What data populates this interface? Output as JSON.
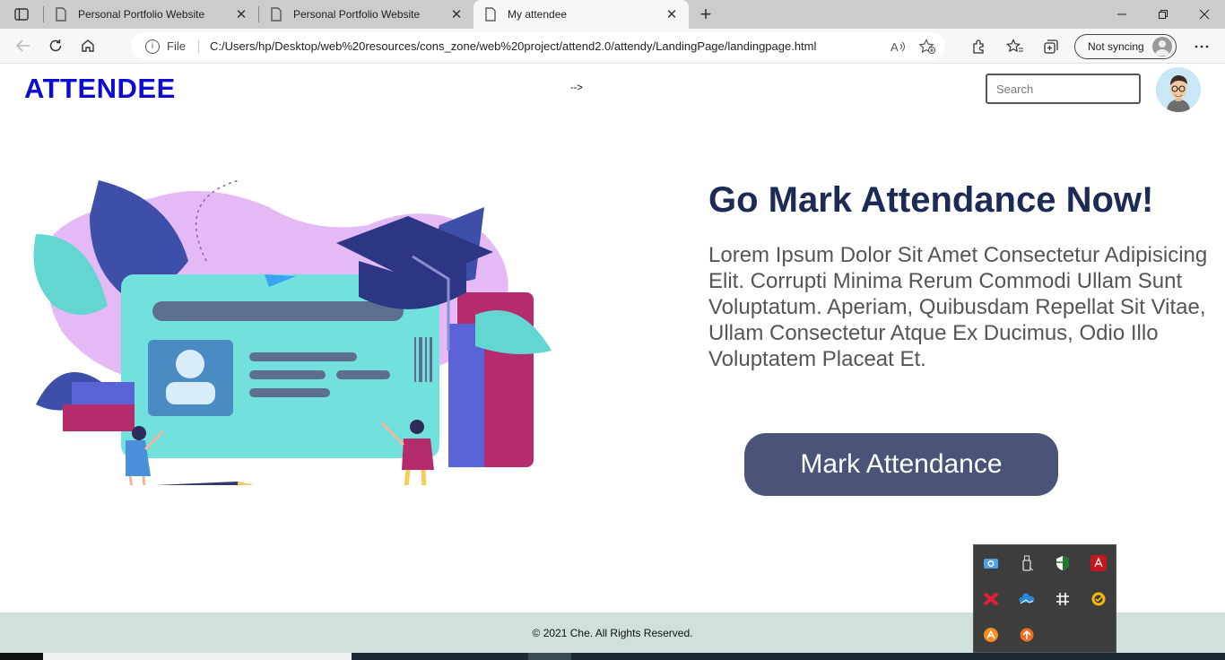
{
  "browser": {
    "tabs": [
      {
        "title": "Personal Portfolio Website",
        "active": false
      },
      {
        "title": "Personal Portfolio Website",
        "active": false
      },
      {
        "title": "My attendee",
        "active": true
      }
    ],
    "new_tab_label": "+",
    "address": {
      "scheme_label": "File",
      "url": "C:/Users/hp/Desktop/web%20resources/cons_zone/web%20project/attend2.0/attendy/LandingPage/landingpage.html"
    },
    "sync_label": "Not syncing"
  },
  "page": {
    "logo": "ATTENDEE",
    "arrow_text": "-->",
    "search_placeholder": "Search",
    "hero": {
      "title": "Go Mark Attendance Now!",
      "text": "Lorem Ipsum Dolor Sit Amet Consectetur Adipisicing Elit. Corrupti Minima Rerum Commodi Ullam Sunt Voluptatum. Aperiam, Quibusdam Repellat Sit Vitae, Ullam Consectetur Atque Ex Ducimus, Odio Illo Voluptatem Placeat Et.",
      "button_label": "Mark Attendance"
    },
    "footer": "© 2021 Che. All Rights Reserved."
  },
  "colors": {
    "logo": "#0b0bd1",
    "hero_title": "#1c2a55",
    "button": "#4a5478",
    "footer_bg": "#cfe0dd"
  },
  "tray_icons": [
    "camera-icon",
    "usb-drive-icon",
    "shield-icon",
    "adobe-icon",
    "red-app-icon",
    "onedrive-icon",
    "slack-icon",
    "norton-icon",
    "avast-icon",
    "update-icon"
  ]
}
